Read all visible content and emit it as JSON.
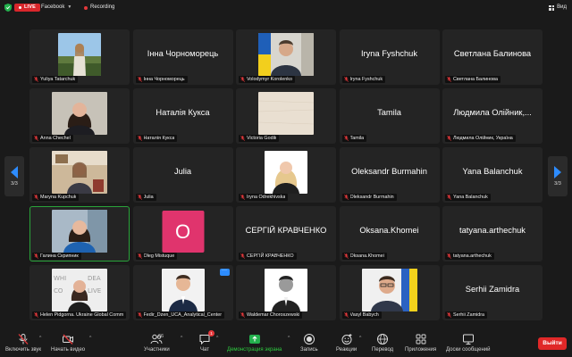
{
  "topbar": {
    "live_label": "LIVE",
    "live_target": "Facebook",
    "recording_label": "Recording",
    "view_label": "Вид"
  },
  "nav": {
    "left_page": "3/3",
    "right_page": "3/3"
  },
  "tiles": [
    {
      "caption": "Yuliya Tatarchuk",
      "kind": "photo",
      "scene": "outdoor"
    },
    {
      "caption": "Інна Чорноморець",
      "name": "Інна Чорноморець",
      "kind": "name"
    },
    {
      "caption": "Volodymyr Korolenko",
      "kind": "photo",
      "scene": "flag-man"
    },
    {
      "caption": "Iryna Fyshchuk",
      "name": "Iryna Fyshchuk",
      "kind": "name"
    },
    {
      "caption": "Светлана Балинова",
      "name": "Светлана Балинова",
      "kind": "name"
    },
    {
      "caption": "Anna Chechel",
      "kind": "photo",
      "scene": "woman-dark"
    },
    {
      "caption": "Наталія Кукса",
      "name": "Наталія Кукса",
      "kind": "name"
    },
    {
      "caption": "Victoria Godik",
      "kind": "photo",
      "scene": "beige"
    },
    {
      "caption": "Tamila",
      "name": "Tamila",
      "kind": "name"
    },
    {
      "caption": "Людмила Олійник, Україна",
      "name": "Людмила Олійник,...",
      "kind": "name"
    },
    {
      "caption": "Maryna Kupchuk",
      "kind": "photo",
      "scene": "office"
    },
    {
      "caption": "Julia",
      "name": "Julia",
      "kind": "name"
    },
    {
      "caption": "Iryna Odrekhivska",
      "kind": "photo",
      "scene": "blonde"
    },
    {
      "caption": "Oleksandr Burmahin",
      "name": "Oleksandr Burmahin",
      "kind": "name"
    },
    {
      "caption": "Yana Balanchuk",
      "name": "Yana Balanchuk",
      "kind": "name"
    },
    {
      "caption": "Галина Скрипник",
      "kind": "photo",
      "scene": "woman-blue",
      "active": true
    },
    {
      "caption": "Oleg Mistuque",
      "avatar": "O",
      "kind": "avatar"
    },
    {
      "caption": "СЕРГІЙ КРАВЧЕНКО",
      "name": "СЕРГІЙ КРАВЧЕНКО",
      "kind": "name"
    },
    {
      "caption": "Oksana.Khomei",
      "name": "Oksana.Khomei",
      "kind": "name"
    },
    {
      "caption": "tatyana.arthechuk",
      "name": "tatyana.arthechuk",
      "kind": "name"
    },
    {
      "caption": "Helen Pidgorna. Ukraine Global Comm",
      "kind": "photo",
      "scene": "banner"
    },
    {
      "caption": "Fedir_Dzen_UCA_Analytical_Center",
      "kind": "photo",
      "scene": "man-suit",
      "more": "···"
    },
    {
      "caption": "Waldemar Choroszewski",
      "kind": "photo",
      "scene": "man-bw"
    },
    {
      "caption": "Vasyl Babych",
      "kind": "photo",
      "scene": "man-glasses"
    },
    {
      "caption": "Serhii Zamidra",
      "name": "Serhii Zamidra",
      "kind": "name"
    }
  ],
  "toolbar": {
    "mute_label": "Включить звук",
    "video_label": "Начать видео",
    "participants_label": "Участники",
    "participants_count": "66",
    "chat_label": "Чат",
    "chat_badge": "1",
    "share_label": "Демонстрация экрана",
    "record_label": "Запись",
    "reactions_label": "Реакции",
    "translate_label": "Перевод",
    "apps_label": "Приложения",
    "whiteboard_label": "Доски сообщений",
    "leave_label": "Выйти"
  },
  "colors": {
    "accent_blue": "#2d8cff",
    "live_red": "#d9262b",
    "share_green": "#2ecc40",
    "avatar_pink": "#e0346d",
    "leave_red": "#e02828"
  }
}
